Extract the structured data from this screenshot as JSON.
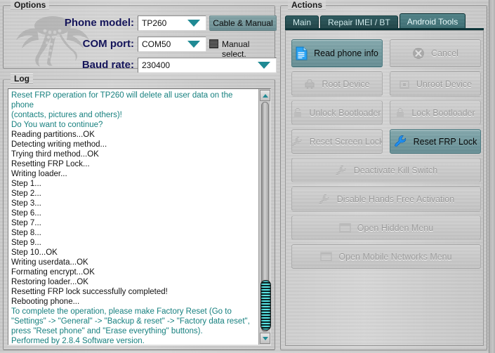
{
  "options": {
    "group_title": "Options",
    "logo": "octopus-logo",
    "phone_model": {
      "label": "Phone model:",
      "value": "TP260"
    },
    "com_port": {
      "label": "COM port:",
      "value": "COM50"
    },
    "baud_rate": {
      "label": "Baud rate:",
      "value": "230400"
    },
    "cable_manual_button": "Cable & Manual",
    "manual_select": {
      "label": "Manual select.",
      "checked": false
    }
  },
  "log": {
    "group_title": "Log",
    "lines": [
      {
        "text": "Reset FRP operation for TP260 will delete all user data on the phone",
        "color": "teal"
      },
      {
        "text": "(contacts, pictures and others)!",
        "color": "teal"
      },
      {
        "text": "Do You want to continue?",
        "color": "teal"
      },
      {
        "text": "Reading partitions...OK",
        "color": "black"
      },
      {
        "text": "Detecting writing method...",
        "color": "black"
      },
      {
        "text": "Trying third method...OK",
        "color": "black"
      },
      {
        "text": "Resetting FRP Lock...",
        "color": "black"
      },
      {
        "text": "Writing loader...",
        "color": "black"
      },
      {
        "text": "Step 1...",
        "color": "black"
      },
      {
        "text": "Step 2...",
        "color": "black"
      },
      {
        "text": "Step 3...",
        "color": "black"
      },
      {
        "text": "Step 6...",
        "color": "black"
      },
      {
        "text": "Step 7...",
        "color": "black"
      },
      {
        "text": "Step 8...",
        "color": "black"
      },
      {
        "text": "Step 9...",
        "color": "black"
      },
      {
        "text": "Step 10...OK",
        "color": "black"
      },
      {
        "text": "Writing userdata...OK",
        "color": "black"
      },
      {
        "text": "Formating encrypt...OK",
        "color": "black"
      },
      {
        "text": "Restoring loader...OK",
        "color": "black"
      },
      {
        "text": "Resetting FRP lock successfully completed!",
        "color": "black"
      },
      {
        "text": "Rebooting phone...",
        "color": "black"
      },
      {
        "text": "To complete the operation, please make Factory Reset (Go to \"Settings\" -> \"General\" -> \"Backup & reset\" -> \"Factory data reset\", press \"Reset phone\" and \"Erase everything\" buttons).",
        "color": "teal"
      },
      {
        "text": "Performed by 2.8.4 Software version.",
        "color": "teal"
      }
    ],
    "scrollbar": {
      "up_icon": "triangle-up-icon",
      "down_icon": "triangle-down-icon",
      "thumb_position": "bottom"
    }
  },
  "actions": {
    "group_title": "Actions",
    "tabs": [
      {
        "label": "Main",
        "active": false
      },
      {
        "label": "Repair IMEI / BT",
        "active": false
      },
      {
        "label": "Android Tools",
        "active": true
      }
    ],
    "buttons": [
      {
        "label": "Read phone info",
        "icon": "document-icon",
        "state": "enabled"
      },
      {
        "label": "Cancel",
        "icon": "cancel-x-icon",
        "state": "disabled"
      },
      {
        "label": "Root Device",
        "icon": "root-icon",
        "state": "disabled"
      },
      {
        "label": "Unroot Device",
        "icon": "unroot-icon",
        "state": "disabled"
      },
      {
        "label": "Unlock Bootloader",
        "icon": "unlock-icon",
        "state": "disabled"
      },
      {
        "label": "Lock Bootloader",
        "icon": "lock-icon",
        "state": "disabled"
      },
      {
        "label": "Reset Screen Lock",
        "icon": "wrench-icon",
        "state": "disabled"
      },
      {
        "label": "Reset FRP Lock",
        "icon": "wrench-icon",
        "state": "enabled"
      },
      {
        "label": "Deactivate Kill Switch",
        "icon": "wrench-icon",
        "state": "disabled"
      },
      {
        "label": "Disable Hands Free Activation",
        "icon": "wrench-icon",
        "state": "disabled"
      },
      {
        "label": "Open Hidden Menu",
        "icon": "window-icon",
        "state": "disabled"
      },
      {
        "label": "Open Mobile Networks Menu",
        "icon": "window-icon",
        "state": "disabled"
      }
    ]
  },
  "colors": {
    "accent_teal": "#1f8a94",
    "log_teal_text": "#17807f",
    "label_navy": "#14145a",
    "icon_blue": "#2e9ff0",
    "panel_gray": "#c5c5c5"
  }
}
